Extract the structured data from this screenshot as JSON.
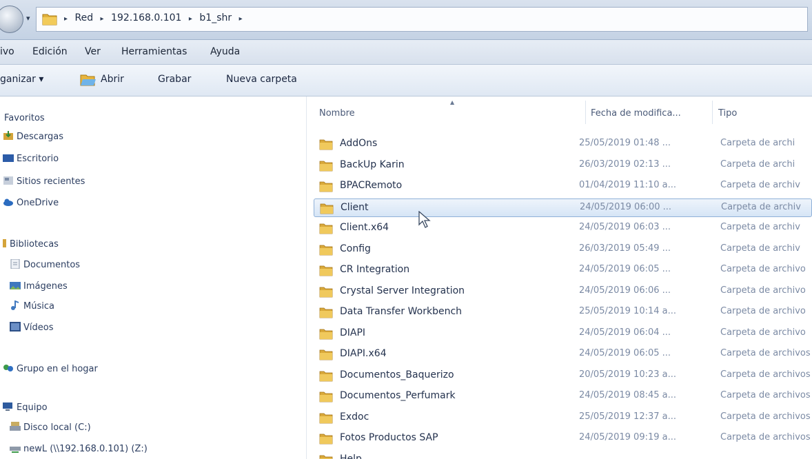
{
  "address": {
    "crumbs": [
      "Red",
      "192.168.0.101",
      "b1_shr"
    ],
    "arrow": "▸",
    "dropdown": "▾"
  },
  "menu": {
    "archivo": "ivo",
    "edicion": "Edición",
    "ver": "Ver",
    "herramientas": "Herramientas",
    "ayuda": "Ayuda"
  },
  "toolbar": {
    "organizar": "ganizar ▾",
    "abrir": "Abrir",
    "grabar": "Grabar",
    "nueva_carpeta": "Nueva carpeta"
  },
  "navpane": {
    "favoritos": "Favoritos",
    "descargas": "Descargas",
    "escritorio": "Escritorio",
    "sitios_recientes": "Sitios recientes",
    "onedrive": "OneDrive",
    "bibliotecas": "Bibliotecas",
    "documentos": "Documentos",
    "imagenes": "Imágenes",
    "musica": "Música",
    "videos": "Vídeos",
    "grupo_hogar": "Grupo en el hogar",
    "equipo": "Equipo",
    "disco_local": "Disco local (C:)",
    "newl": "newL (\\\\192.168.0.101) (Z:)"
  },
  "columns": {
    "nombre": "Nombre",
    "fecha": "Fecha de modifica...",
    "tipo": "Tipo"
  },
  "files": [
    {
      "name": "AddOns",
      "date": "25/05/2019 01:48 ...",
      "type": "Carpeta de archi"
    },
    {
      "name": "BackUp Karin",
      "date": "26/03/2019 02:13 ...",
      "type": "Carpeta de archi"
    },
    {
      "name": "BPACRemoto",
      "date": "01/04/2019 11:10 a...",
      "type": "Carpeta de archiv"
    },
    {
      "name": "Client",
      "date": "24/05/2019 06:00 ...",
      "type": "Carpeta de archiv",
      "selected": true
    },
    {
      "name": "Client.x64",
      "date": "24/05/2019 06:03 ...",
      "type": "Carpeta de archiv"
    },
    {
      "name": "Config",
      "date": "26/03/2019 05:49 ...",
      "type": "Carpeta de archiv"
    },
    {
      "name": "CR Integration",
      "date": "24/05/2019 06:05 ...",
      "type": "Carpeta de archivo"
    },
    {
      "name": "Crystal Server Integration",
      "date": "24/05/2019 06:06 ...",
      "type": "Carpeta de archivo"
    },
    {
      "name": "Data Transfer Workbench",
      "date": "25/05/2019 10:14 a...",
      "type": "Carpeta de archivo"
    },
    {
      "name": "DIAPI",
      "date": "24/05/2019 06:04 ...",
      "type": "Carpeta de archivo"
    },
    {
      "name": "DIAPI.x64",
      "date": "24/05/2019 06:05 ...",
      "type": "Carpeta de archivos"
    },
    {
      "name": "Documentos_Baquerizo",
      "date": "20/05/2019 10:23 a...",
      "type": "Carpeta de archivos"
    },
    {
      "name": "Documentos_Perfumark",
      "date": "24/05/2019 08:45 a...",
      "type": "Carpeta de archivos"
    },
    {
      "name": "Exdoc",
      "date": "25/05/2019 12:37 a...",
      "type": "Carpeta de archivos"
    },
    {
      "name": "Fotos Productos SAP",
      "date": "24/05/2019 09:19 a...",
      "type": "Carpeta de archivos"
    },
    {
      "name": "Help",
      "date": "",
      "type": ""
    }
  ]
}
